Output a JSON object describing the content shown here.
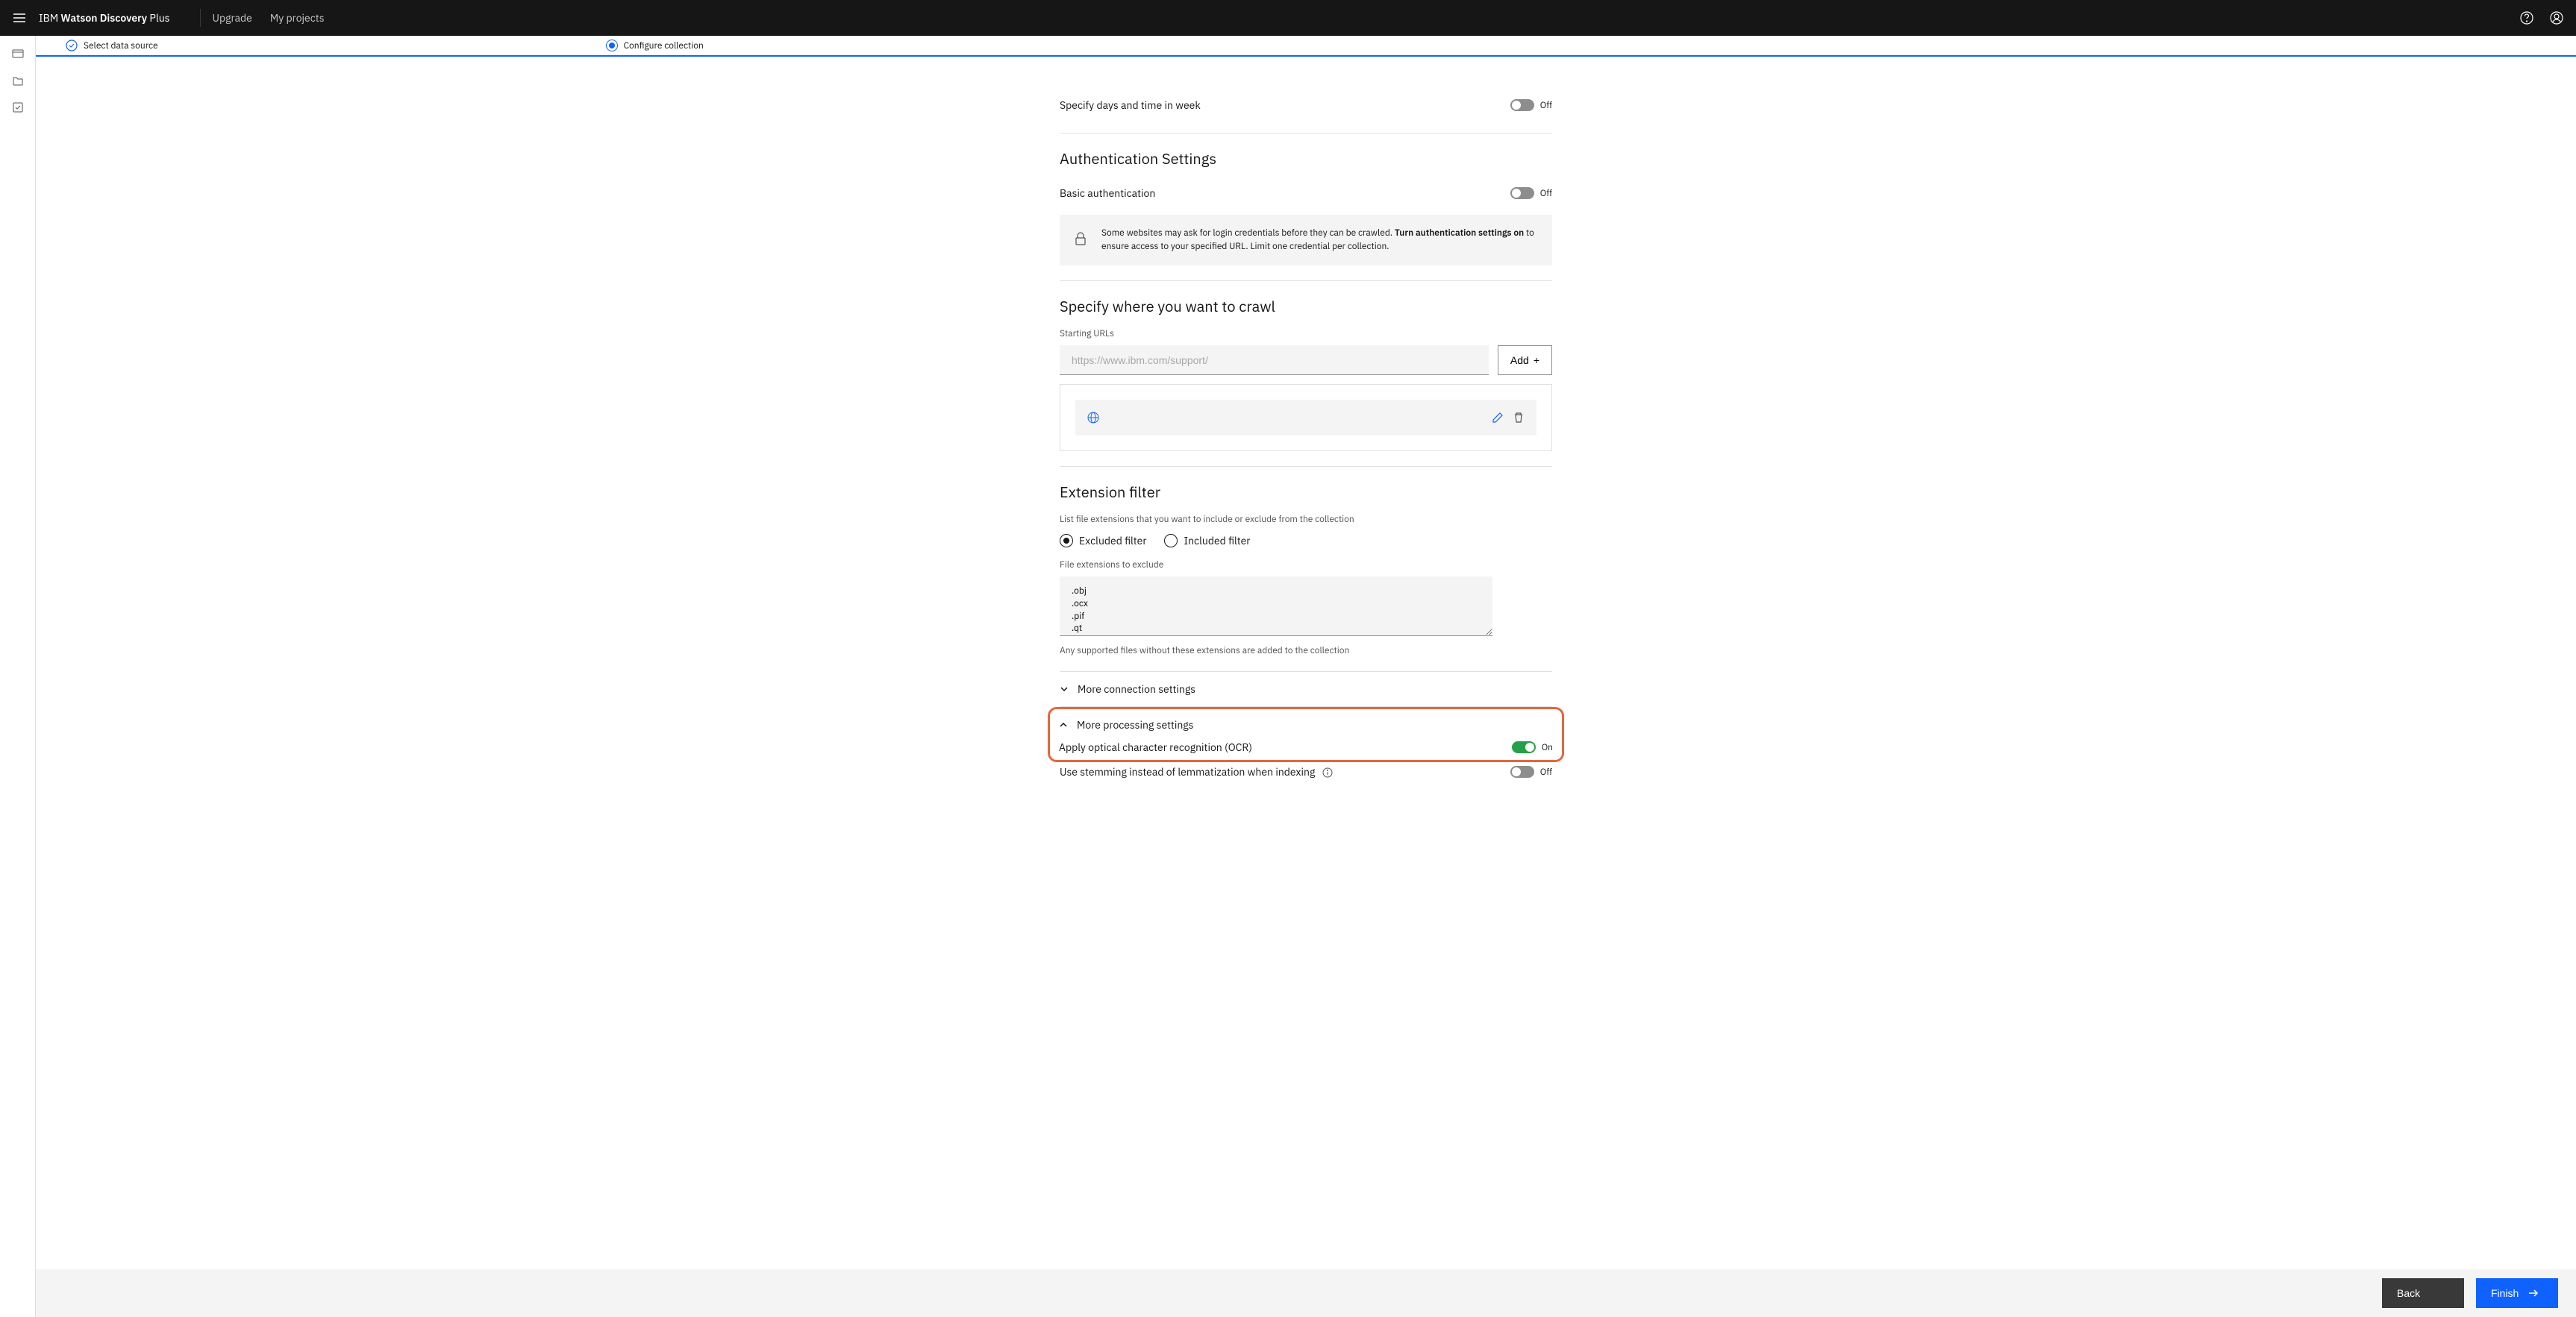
{
  "header": {
    "brand_prefix": "IBM ",
    "brand_bold": "Watson Discovery",
    "brand_suffix": " Plus",
    "upgrade": "Upgrade",
    "my_projects": "My projects"
  },
  "progress": {
    "step1": "Select data source",
    "step2": "Configure collection"
  },
  "schedule": {
    "specify_days_label": "Specify days and time in week",
    "specify_days_state": "Off"
  },
  "auth": {
    "title": "Authentication Settings",
    "basic_label": "Basic authentication",
    "basic_state": "Off",
    "info_pre": "Some websites may ask for login credentials before they can be crawled. ",
    "info_bold": "Turn authentication settings on",
    "info_post": " to ensure access to your specified URL. Limit one credential per collection."
  },
  "crawl": {
    "title": "Specify where you want to crawl",
    "starting_urls_label": "Starting URLs",
    "url_placeholder": "https://www.ibm.com/support/",
    "add_button": "Add"
  },
  "extfilter": {
    "title": "Extension filter",
    "desc": "List file extensions that you want to include or exclude from the collection",
    "excluded_label": "Excluded filter",
    "included_label": "Included filter",
    "extensions_label": "File extensions to exclude",
    "extensions_value": ".obj\n.ocx\n.pif\n.qt\n.ra",
    "help": "Any supported files without these extensions are added to the collection"
  },
  "accordions": {
    "connection": "More connection settings",
    "processing": "More processing settings"
  },
  "processing": {
    "ocr_label": "Apply optical character recognition (OCR)",
    "ocr_state": "On",
    "stemming_label": "Use stemming instead of lemmatization when indexing",
    "stemming_state": "Off"
  },
  "footer": {
    "back": "Back",
    "finish": "Finish"
  }
}
